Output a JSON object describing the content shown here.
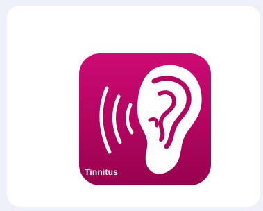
{
  "app": {
    "name": "Tinnitus",
    "icon": "ear-sound-waves-icon",
    "colors": {
      "icon_bg_top": "#cc0b74",
      "icon_bg_bottom": "#96034e",
      "card_bg": "#ffffff",
      "page_bg": "#edf0f8",
      "foreground": "#ffffff"
    }
  }
}
